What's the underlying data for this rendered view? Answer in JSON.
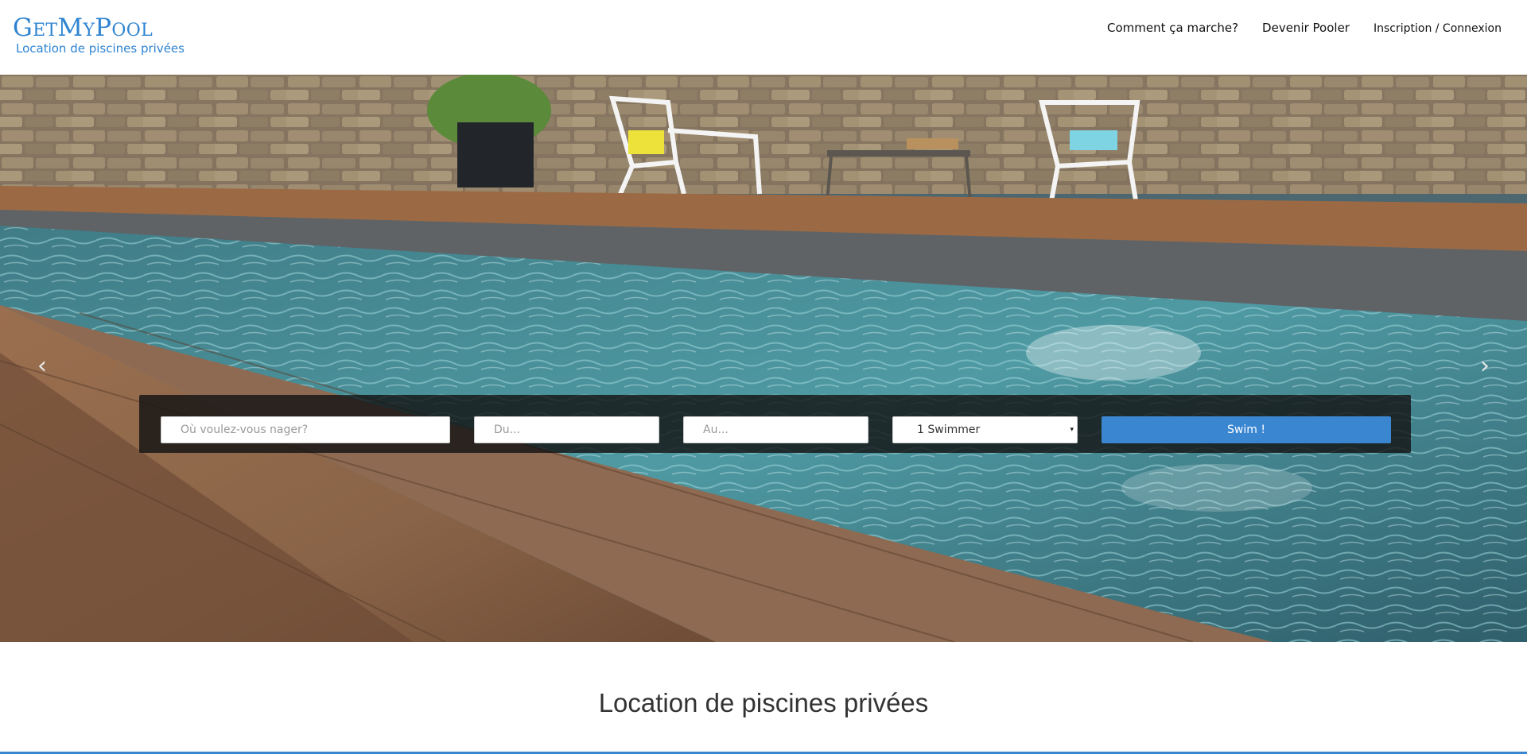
{
  "brand": {
    "name": "GetMyPool",
    "tagline": "Location de piscines privées",
    "color": "#2f84d1"
  },
  "nav": {
    "how_it_works": "Comment ça marche?",
    "become_pooler": "Devenir Pooler",
    "signin": "Inscription / Connexion"
  },
  "hero": {
    "prev_icon": "chevron-left-icon",
    "next_icon": "chevron-right-icon"
  },
  "search": {
    "where_placeholder": "Où voulez-vous nager?",
    "from_placeholder": "Du...",
    "to_placeholder": "Au...",
    "swimmers_selected": "1 Swimmer",
    "submit_label": "Swim !",
    "accent": "#3a86d1"
  },
  "main": {
    "title": "Location de piscines privées"
  }
}
